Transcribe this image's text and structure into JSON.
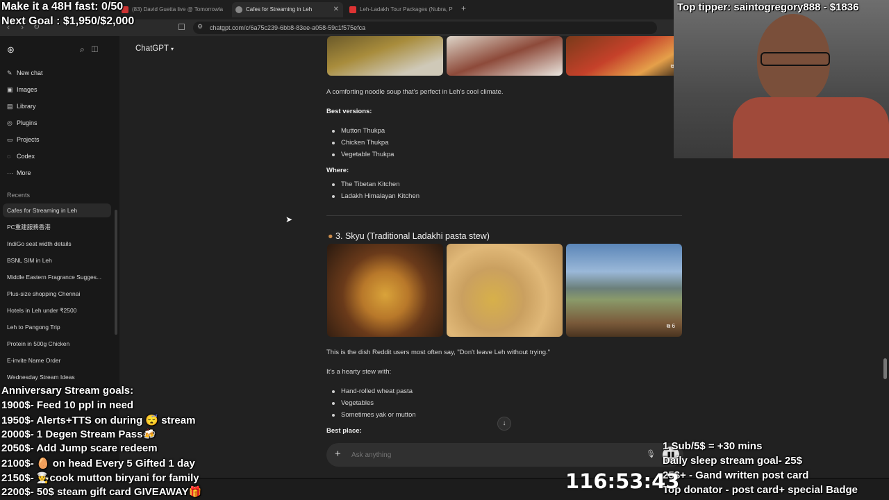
{
  "browser": {
    "tabs": [
      {
        "label": "(83) David Guetta live @ Tomorrowla"
      },
      {
        "label": "Cafes for Streaming in Leh"
      },
      {
        "label": "Leh-Ladakh Tour Packages (Nubra, P"
      }
    ],
    "url": "chatgpt.com/c/6a75c239-6bb8-83ee-a058-59c1f575efca"
  },
  "sidebar": {
    "nav": [
      {
        "label": "New chat",
        "icon": "edit-icon"
      },
      {
        "label": "Images",
        "icon": "image-icon"
      },
      {
        "label": "Library",
        "icon": "library-icon"
      },
      {
        "label": "Plugins",
        "icon": "plugin-icon"
      },
      {
        "label": "Projects",
        "icon": "folder-icon"
      },
      {
        "label": "Codex",
        "icon": "codex-icon"
      },
      {
        "label": "More",
        "icon": "more-icon"
      }
    ],
    "recents_heading": "Recents",
    "recents": [
      "Cafes for Streaming in Leh",
      "PC重建服務香港",
      "IndiGo seat width details",
      "BSNL SIM in Leh",
      "Middle Eastern Fragrance Sugges...",
      "Plus-size shopping Chennai",
      "Hotels in Leh under ₹2500",
      "Leh to Pangong Trip",
      "Protein in 500g Chicken",
      "E-invite Name Order",
      "Wednesday Stream Ideas"
    ]
  },
  "header": {
    "model": "ChatGPT"
  },
  "content": {
    "intro": "A comforting noodle soup that's perfect in Leh's cool climate.",
    "best_versions_label": "Best versions:",
    "best_versions": [
      "Mutton Thukpa",
      "Chicken Thukpa",
      "Vegetable Thukpa"
    ],
    "where_label": "Where:",
    "where": [
      "The Tibetan Kitchen",
      "Ladakh Himalayan Kitchen"
    ],
    "section3_title": "3. Skyu (Traditional Ladakhi pasta stew)",
    "image_count": "6",
    "top_image_count": "6",
    "skyu_desc": "This is the dish Reddit users most often say, \"Don't leave Leh without trying.\"",
    "stew_label": "It's a hearty stew with:",
    "stew_items": [
      "Hand-rolled wheat pasta",
      "Vegetables",
      "Sometimes yak or mutton"
    ],
    "best_place_label": "Best place:"
  },
  "composer": {
    "placeholder": "Ask anything"
  },
  "overlays": {
    "fast": "Make it a 48H fast: 0/50",
    "goal": "Next Goal : $1,950/$2,000",
    "top_tipper": "Top tipper: saintogregory888 - $1836",
    "anniv_title": "Anniversary Stream goals:",
    "anniv_goals": [
      "1900$- Feed 10 ppl in need",
      "1950$- Alerts+TTS on during 😴 stream",
      "2000$- 1 Degen Stream Pass🍻",
      "2050$- Add Jump scare redeem",
      "2100$- 🥚 on head Every 5 Gifted 1 day",
      "2150$- 👨‍🍳cook mutton biryani for family",
      "2200$- 50$ steam gift card GIVEAWAY🎁"
    ],
    "sub_info": [
      "1 Sub/5$ = +30 mins",
      "Daily sleep stream goal- 25$",
      "25$+ - Gand written post card",
      "Top donator - post card+ special Badge"
    ],
    "timer": "116:53:43"
  },
  "colors": {
    "sidebar_bg": "#181818",
    "main_bg": "#212121",
    "composer_bg": "#303030"
  }
}
